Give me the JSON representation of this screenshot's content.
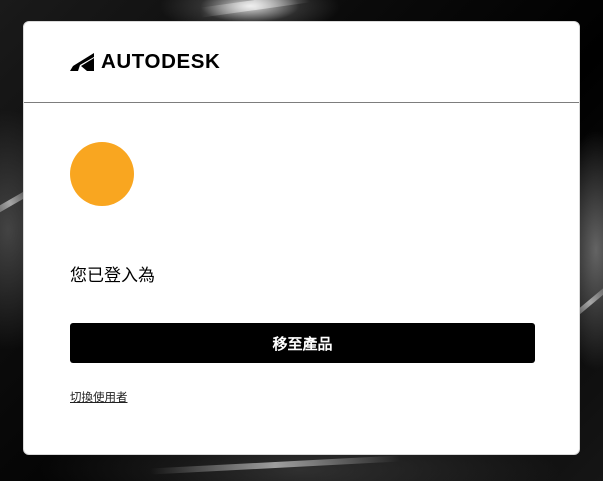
{
  "brand": {
    "name": "AUTODESK",
    "logo_icon": "autodesk-logo-mark"
  },
  "account": {
    "avatar_color": "#F9A620",
    "signed_in_label": "您已登入為"
  },
  "actions": {
    "primary_label": "移至產品",
    "switch_user_label": "切換使用者"
  },
  "colors": {
    "card_background": "#FFFFFF",
    "button_background": "#000000",
    "button_text": "#FFFFFF",
    "divider": "#7D7D7D"
  }
}
